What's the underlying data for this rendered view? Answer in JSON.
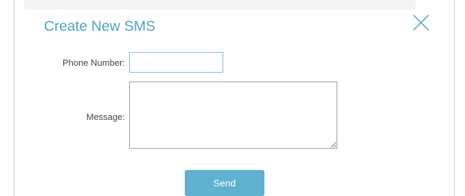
{
  "dialog": {
    "title": "Create New SMS",
    "close_icon": "close-icon"
  },
  "form": {
    "phone_label": "Phone Number:",
    "phone_value": "",
    "message_label": "Message:",
    "message_value": "",
    "send_label": "Send"
  },
  "colors": {
    "accent": "#4fa3c7",
    "button": "#5fb1cf",
    "input_focus_border": "#7fb9d6"
  }
}
